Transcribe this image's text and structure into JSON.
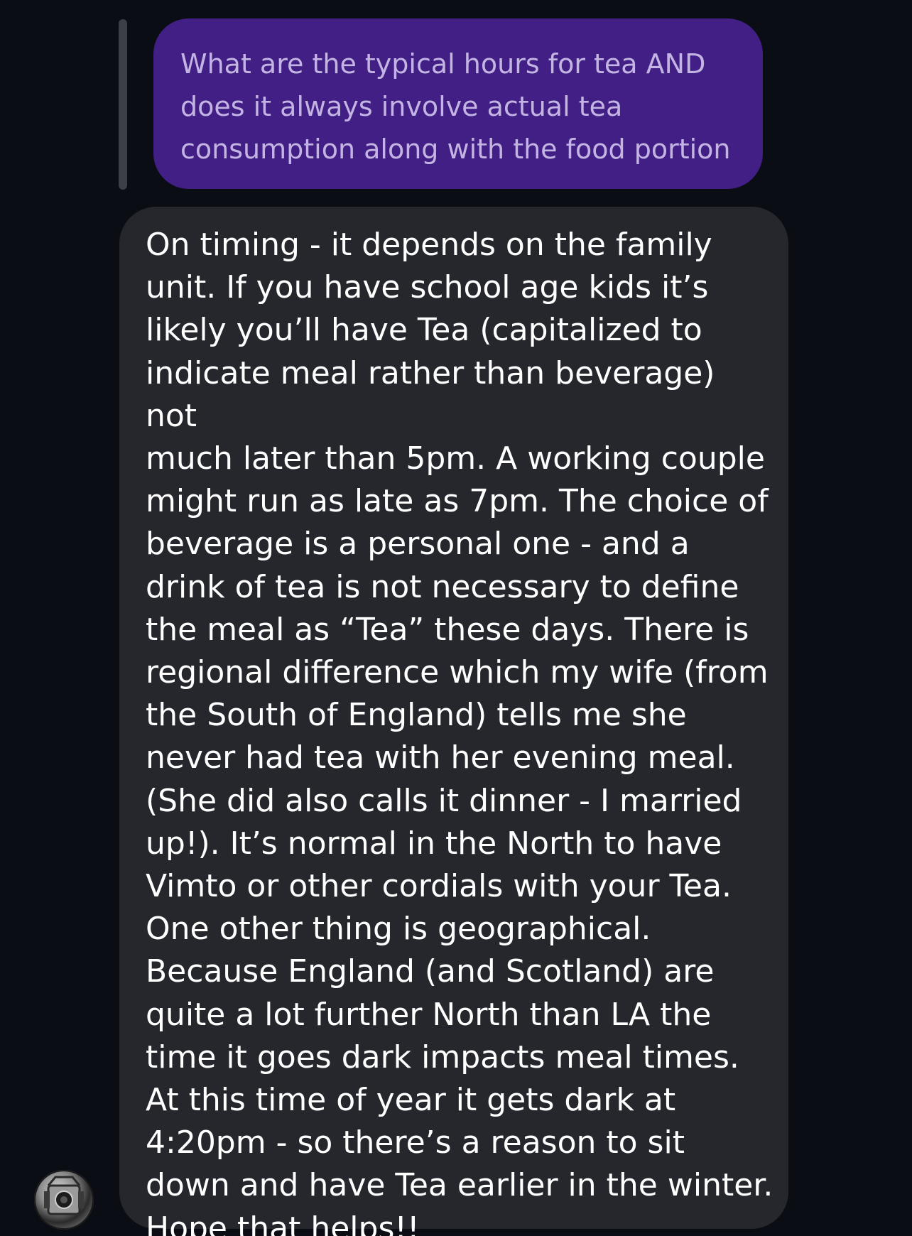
{
  "quoted_message": {
    "text": "What are the typical hours for tea AND\ndoes it always involve actual tea\nconsumption along with the food portion"
  },
  "message": {
    "text": "On timing - it depends on the family\nunit. If you have school age kids it’s\nlikely you’ll have Tea (capitalized to\nindicate meal rather than beverage) not\nmuch later than 5pm. A working couple\nmight run as late as 7pm. The choice of\nbeverage is a personal one - and a\ndrink of tea is not necessary to define\nthe meal as “Tea” these days. There is\nregional difference which my wife (from\nthe South of England) tells me she\nnever had tea with her evening meal.\n(She did also calls it dinner - I married\nup!). It’s normal in the North to have\nVimto or other cordials with your Tea.\nOne other thing is geographical.\nBecause England (and Scotland) are\nquite a lot further North than LA the\ntime it goes dark impacts meal times.\nAt this time of year it gets dark at\n4:20pm - so there’s a reason to sit\ndown and have Tea earlier in the winter.\nHope that helps!!"
  },
  "colors": {
    "background": "#0b0d14",
    "quoted_bubble": "#411f84",
    "quoted_text": "#c3b4e3",
    "message_bubble": "#25272d",
    "message_text": "#ffffff",
    "reply_bar": "#3c3f46"
  },
  "icons": {
    "avatar": "sender-avatar"
  }
}
